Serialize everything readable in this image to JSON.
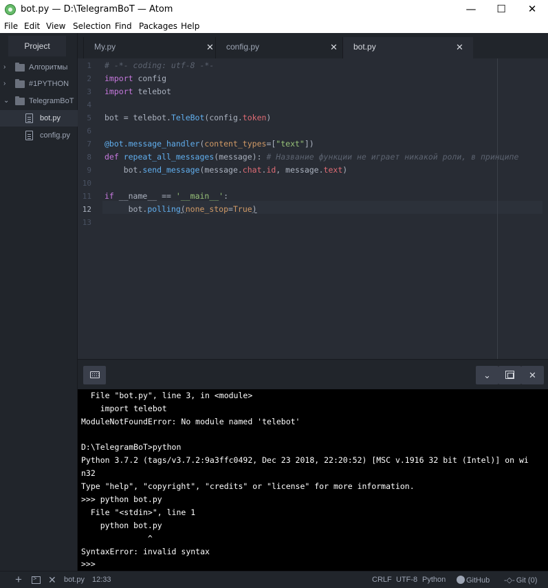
{
  "window": {
    "title": "bot.py — D:\\TelegramBoT — Atom",
    "minimize": "—",
    "maximize": "☐",
    "close": "✕"
  },
  "menu": [
    "File",
    "Edit",
    "View",
    "Selection",
    "Find",
    "Packages",
    "Help"
  ],
  "sidebar": {
    "tab_label": "Project",
    "items": [
      {
        "label": "Алгоритмы",
        "chevron": "›"
      },
      {
        "label": "#1PYTHON",
        "chevron": "›"
      },
      {
        "label": "TelegramBoT",
        "chevron": "⌄"
      },
      {
        "label": "bot.py"
      },
      {
        "label": "config.py"
      }
    ]
  },
  "tabs": [
    {
      "title": "My.py",
      "close": "✕"
    },
    {
      "title": "config.py",
      "close": "✕"
    },
    {
      "title": "bot.py",
      "close": "✕"
    }
  ],
  "editor": {
    "line_numbers": [
      "1",
      "2",
      "3",
      "4",
      "5",
      "6",
      "7",
      "8",
      "9",
      "10",
      "11",
      "12",
      "13"
    ],
    "code": {
      "l1": "# -*- coding: utf-8 -*-",
      "l2_kw": "import",
      "l2_rest": " config",
      "l3_kw": "import",
      "l3_rest": " telebot",
      "l5_a": "bot = telebot.",
      "l5_fn": "TeleBot",
      "l5_b": "(config.",
      "l5_prop": "token",
      "l5_c": ")",
      "l7_fn": "@bot.message_handler",
      "l7_a": "(",
      "l7_attr": "content_types",
      "l7_b": "=[",
      "l7_str": "\"text\"",
      "l7_c": "])",
      "l8_kw": "def",
      "l8_fn": " repeat_all_messages",
      "l8_a": "(message): ",
      "l8_comment": "# Название функции не играет никакой роли, в принципе",
      "l9_a": "    bot.",
      "l9_fn": "send_message",
      "l9_b": "(message.",
      "l9_prop1": "chat",
      "l9_c": ".",
      "l9_prop2": "id",
      "l9_d": ", message.",
      "l9_prop3": "text",
      "l9_e": ")",
      "l11_kw": "if",
      "l11_a": " __name__ == ",
      "l11_str": "'__main__'",
      "l11_b": ":",
      "l12_a": "     bot.",
      "l12_fn": "polling",
      "l12_paren1": "(",
      "l12_attr": "none_stop",
      "l12_b": "=",
      "l12_attr2": "True",
      "l12_paren2": ")"
    }
  },
  "terminal": {
    "buttons": {
      "chevron": "⌄",
      "close": "✕"
    },
    "lines": [
      "  File \"bot.py\", line 3, in <module>",
      "    import telebot",
      "ModuleNotFoundError: No module named 'telebot'",
      "",
      "D:\\TelegramBoT>python",
      "Python 3.7.2 (tags/v3.7.2:9a3ffc0492, Dec 23 2018, 22:20:52) [MSC v.1916 32 bit (Intel)] on wi",
      "n32",
      "Type \"help\", \"copyright\", \"credits\" or \"license\" for more information.",
      ">>> python bot.py",
      "  File \"<stdin>\", line 1",
      "    python bot.py",
      "              ^",
      "SyntaxError: invalid syntax",
      ">>>"
    ]
  },
  "status": {
    "add": "+",
    "close": "✕",
    "file": "bot.py",
    "position": "12:33",
    "line_ending": "CRLF",
    "encoding": "UTF-8",
    "grammar": "Python",
    "github": "GitHub",
    "git": "Git (0)",
    "git_prefix": "-◇-"
  },
  "colors": {
    "editor_bg": "#282c34",
    "panel_bg": "#21252b",
    "terminal_bg": "#000000"
  }
}
